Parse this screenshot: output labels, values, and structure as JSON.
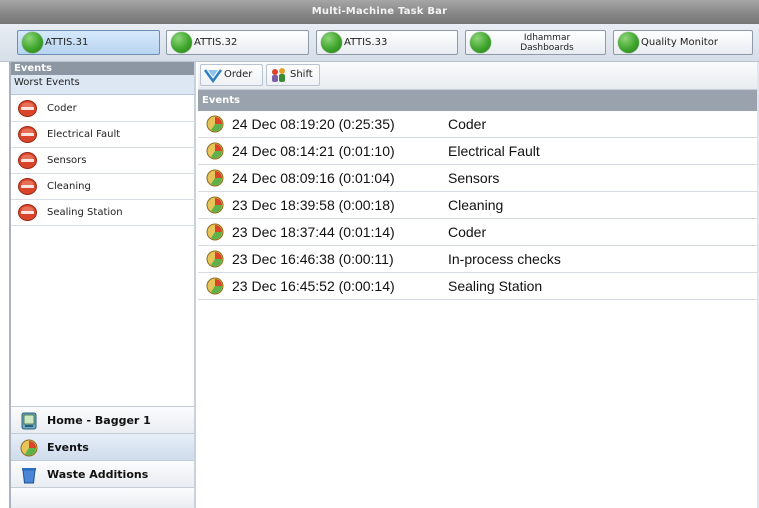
{
  "taskbar": {
    "title": "Multi-Machine Task Bar"
  },
  "machines": [
    {
      "label": "ATTIS.31",
      "active": true
    },
    {
      "label": "ATTIS.32",
      "active": false
    },
    {
      "label": "ATTIS.33",
      "active": false
    },
    {
      "label_line1": "Idhammar",
      "label_line2": "Dashboards",
      "active": false
    },
    {
      "label": "Quality Monitor",
      "active": false
    }
  ],
  "left_panel": {
    "header": "Events",
    "subheader": "Worst Events",
    "worst_events": [
      {
        "label": "Coder",
        "icon": "stop-icon"
      },
      {
        "label": "Electrical Fault",
        "icon": "stop-icon"
      },
      {
        "label": "Sensors",
        "icon": "stop-icon"
      },
      {
        "label": "Cleaning",
        "icon": "stop-icon"
      },
      {
        "label": "Sealing Station",
        "icon": "stop-icon"
      }
    ],
    "nav": [
      {
        "label": "Home - Bagger 1",
        "icon": "home-machine-icon",
        "active": false
      },
      {
        "label": "Events",
        "icon": "events-icon",
        "active": true
      },
      {
        "label": "Waste Additions",
        "icon": "waste-bin-icon",
        "active": false
      }
    ]
  },
  "toolbar": {
    "order_label": "Order",
    "shift_label": "Shift"
  },
  "events": {
    "header": "Events",
    "rows": [
      {
        "timestamp": "24 Dec 08:19:20 (0:25:35)",
        "reason": "Coder"
      },
      {
        "timestamp": "24 Dec 08:14:21 (0:01:10)",
        "reason": "Electrical Fault"
      },
      {
        "timestamp": "24 Dec 08:09:16 (0:01:04)",
        "reason": "Sensors"
      },
      {
        "timestamp": "23 Dec 18:39:58 (0:00:18)",
        "reason": "Cleaning"
      },
      {
        "timestamp": "23 Dec 18:37:44 (0:01:14)",
        "reason": "Coder"
      },
      {
        "timestamp": "23 Dec 16:46:38 (0:00:11)",
        "reason": "In-process checks"
      },
      {
        "timestamp": "23 Dec 16:45:52 (0:00:14)",
        "reason": "Sealing Station"
      }
    ]
  },
  "colors": {
    "status_green": "#3fa52c",
    "stop_red": "#d9452b",
    "active_blue": "#b8d4f0"
  }
}
